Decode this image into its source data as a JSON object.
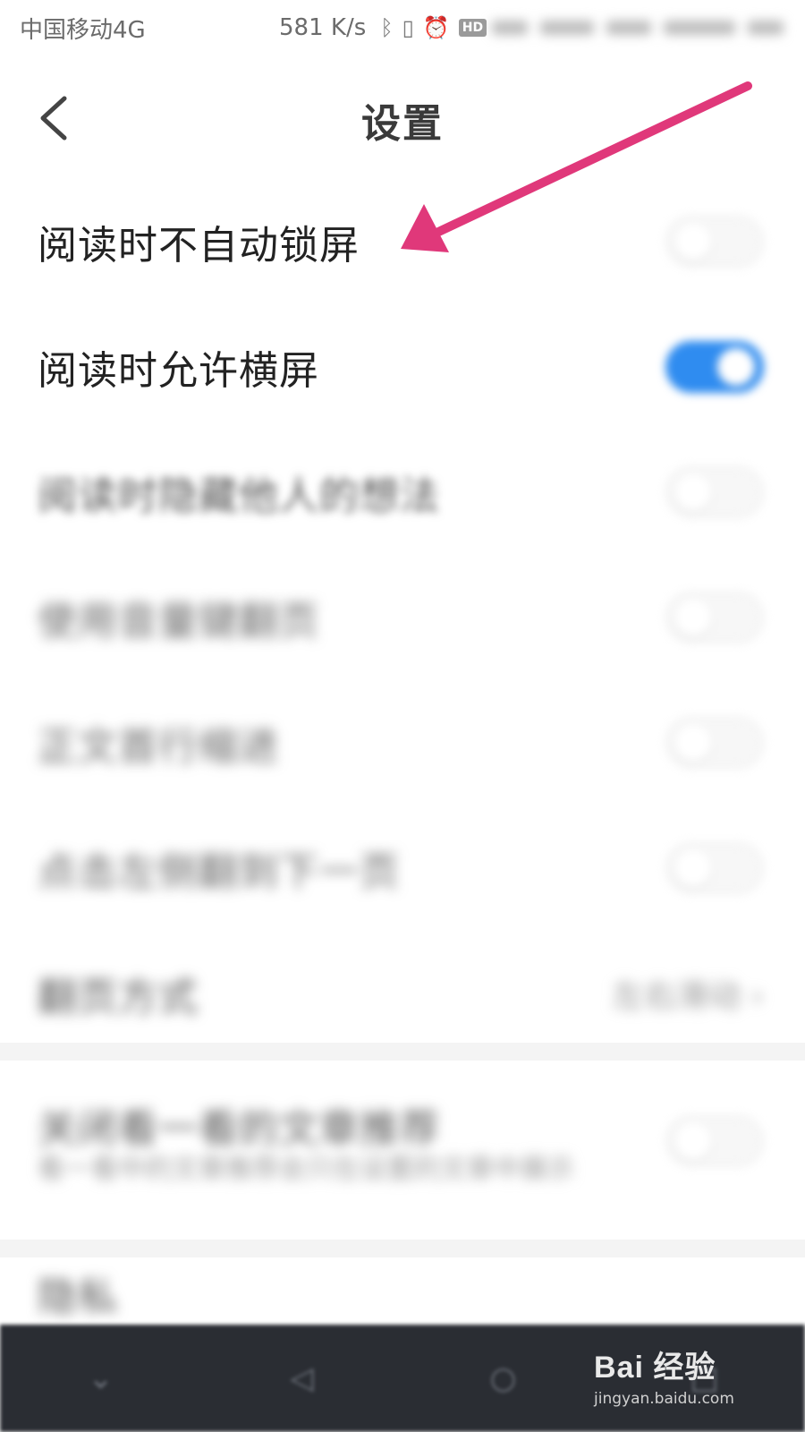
{
  "status_bar": {
    "carrier": "中国移动4G",
    "speed": "581 K/s",
    "hd_badge": "HD"
  },
  "nav": {
    "title": "设置"
  },
  "settings": [
    {
      "label": "阅读时不自动锁屏",
      "toggle": false
    },
    {
      "label": "阅读时允许横屏",
      "toggle": true
    },
    {
      "label": "阅读时隐藏他人的想法",
      "toggle": false
    },
    {
      "label": "使用音量键翻页",
      "toggle": false
    },
    {
      "label": "正文首行缩进",
      "toggle": false
    },
    {
      "label": "点击左侧翻到下一页",
      "toggle": false
    }
  ],
  "page_turn": {
    "label": "翻页方式",
    "value": "左右滑动 ›"
  },
  "recommend": {
    "label": "关闭看一看的文章推荐",
    "subtitle": "看一看中的文章推荐会只在设置的文章中展示",
    "toggle": false
  },
  "privacy": {
    "label": "隐私"
  },
  "colors": {
    "toggle_on": "#2f8cf0",
    "arrow": "#e0387a",
    "bottom_nav_bg": "#2a2d33"
  },
  "watermark": {
    "brand": "Bai 经验",
    "url": "jingyan.baidu.com"
  }
}
